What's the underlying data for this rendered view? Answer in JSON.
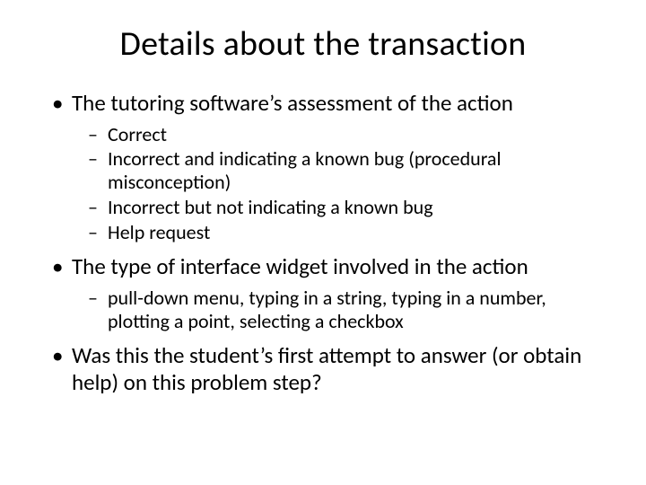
{
  "title": "Details about the transaction",
  "bullets": [
    {
      "text": "The tutoring software’s assessment of the action",
      "sub": [
        "Correct",
        "Incorrect and indicating a known bug (procedural misconception)",
        "Incorrect but not indicating a known bug",
        "Help request"
      ]
    },
    {
      "text": "The type of interface widget involved in the action",
      "sub": [
        "pull-down menu, typing in a string, typing in a number, plotting a point, selecting a checkbox"
      ]
    },
    {
      "text": "Was this the student’s first attempt to answer (or obtain help) on this problem step?",
      "sub": []
    }
  ]
}
